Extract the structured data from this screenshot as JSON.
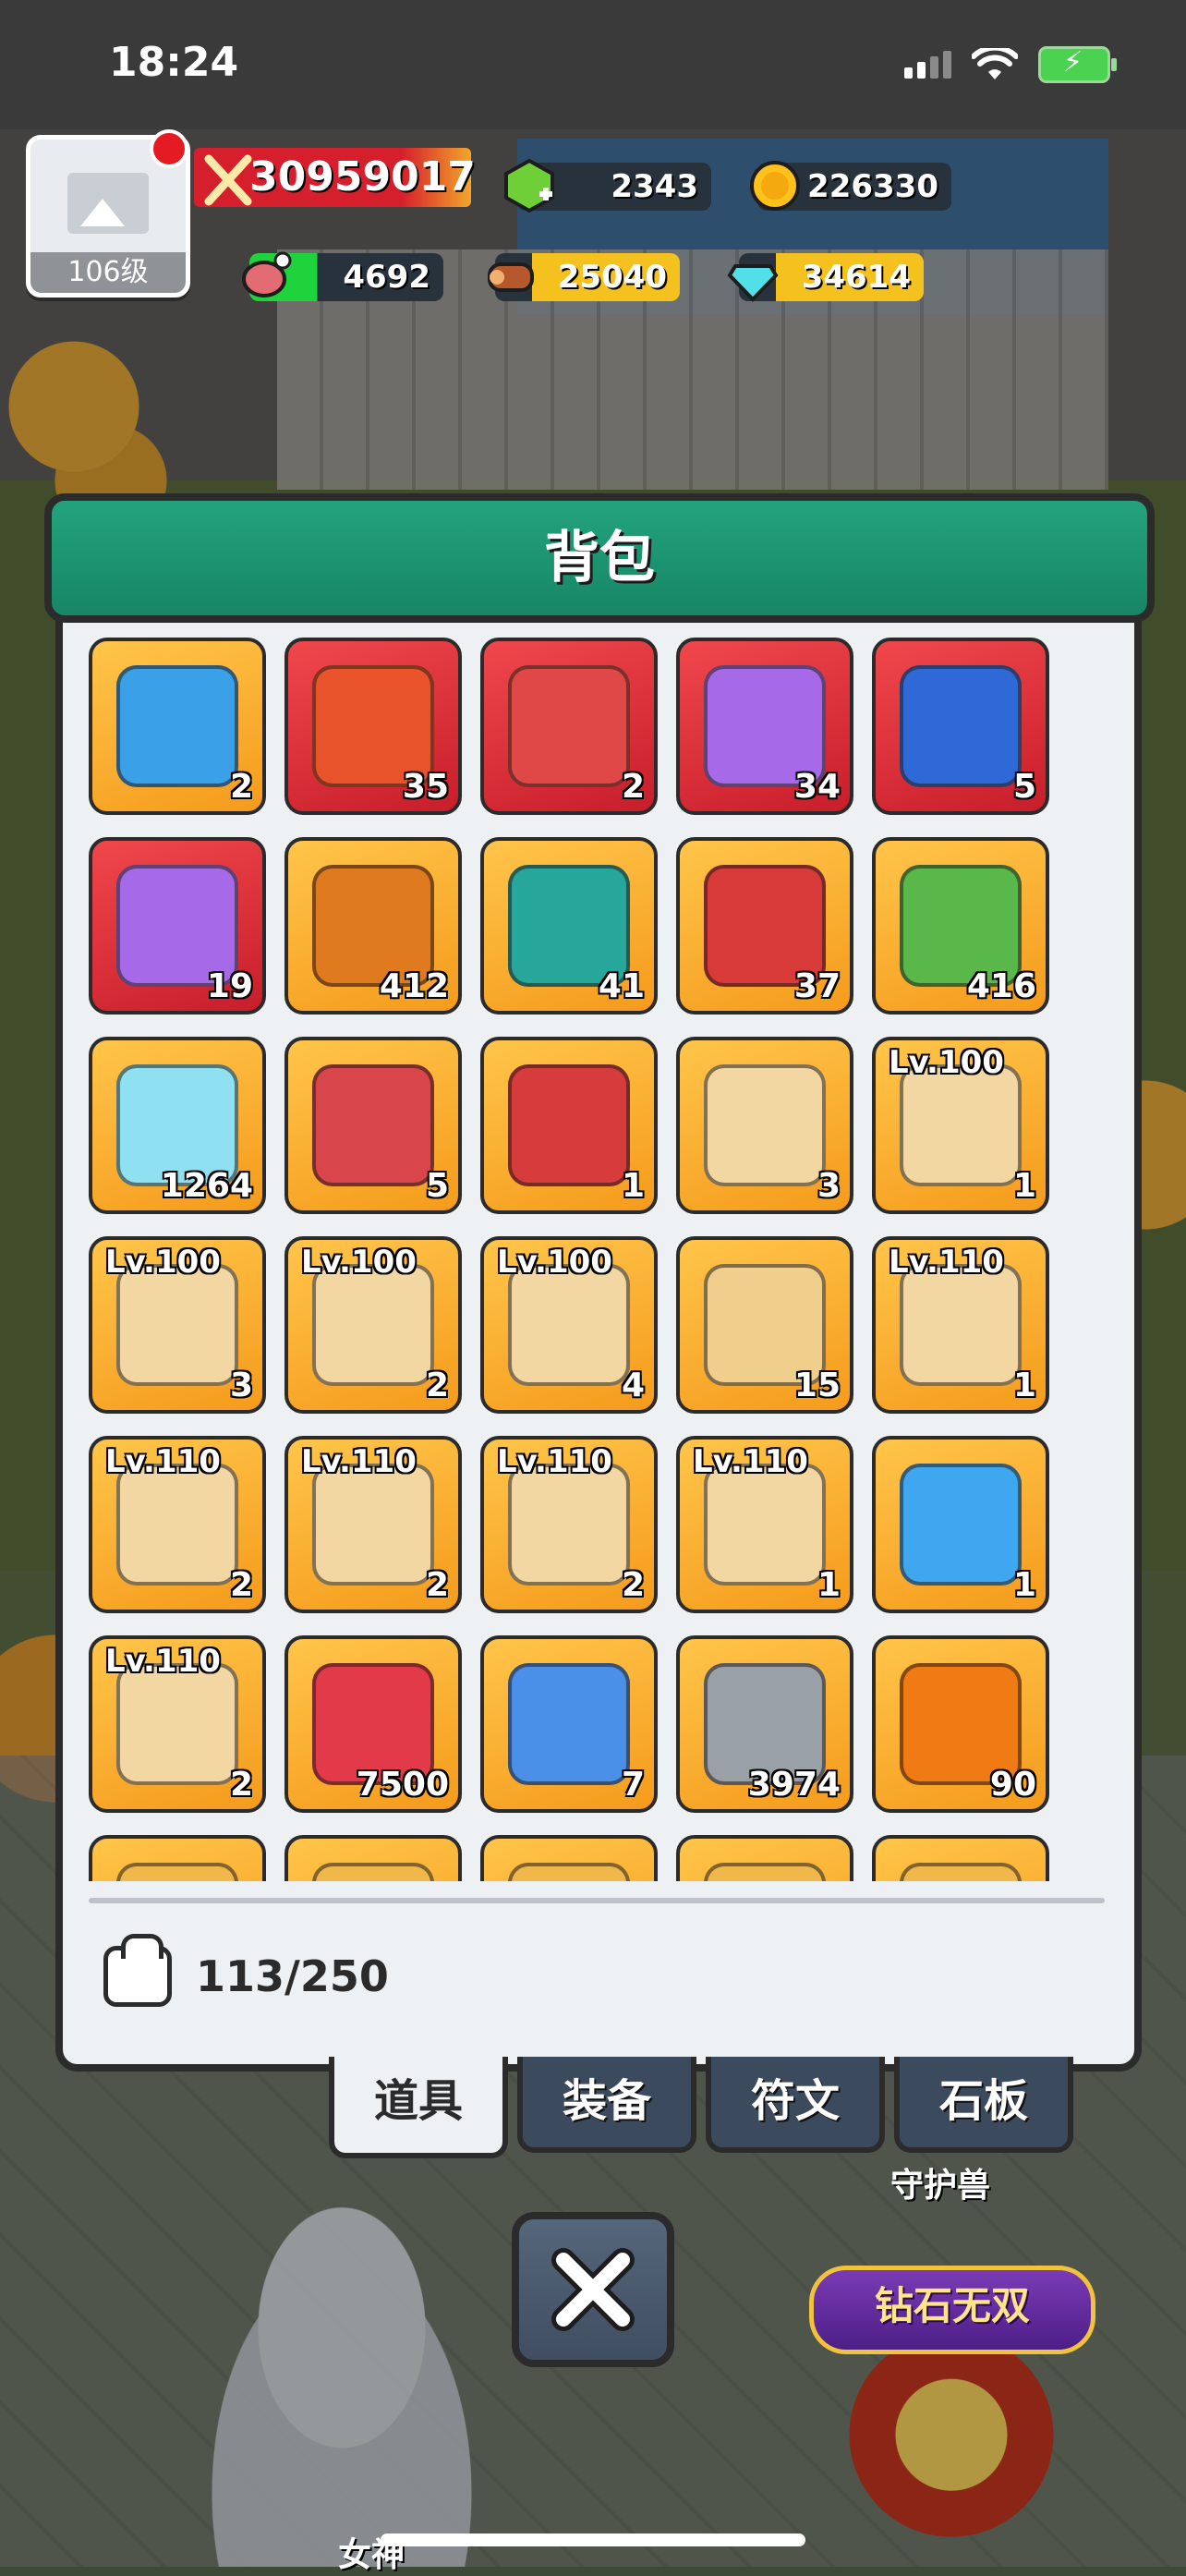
{
  "status_bar": {
    "time": "18:24"
  },
  "player": {
    "level_label": "106级",
    "power": "30959017"
  },
  "resources": {
    "gems_green": "2343",
    "gold": "226330",
    "meat": "4692",
    "wood": "25040",
    "crystal": "34614"
  },
  "panel": {
    "title": "背包",
    "capacity": "113/250"
  },
  "items": [
    {
      "icon": "blue-crown-chest-icon",
      "bg": "gold",
      "count": "2",
      "lv": ""
    },
    {
      "icon": "red-crown-card-icon",
      "bg": "red",
      "count": "35",
      "lv": ""
    },
    {
      "icon": "mystery-red-chest-icon",
      "bg": "red",
      "count": "2",
      "lv": ""
    },
    {
      "icon": "winged-purple-chest-icon",
      "bg": "red",
      "count": "34",
      "lv": ""
    },
    {
      "icon": "royal-blue-chest-icon",
      "bg": "red",
      "count": "5",
      "lv": ""
    },
    {
      "icon": "winged-purple-chest-icon",
      "bg": "red",
      "count": "19",
      "lv": ""
    },
    {
      "icon": "orange-crown-card-icon",
      "bg": "gold",
      "count": "412",
      "lv": ""
    },
    {
      "icon": "teal-gem-chest-icon",
      "bg": "gold",
      "count": "41",
      "lv": ""
    },
    {
      "icon": "red-gem-chest-icon",
      "bg": "gold",
      "count": "37",
      "lv": ""
    },
    {
      "icon": "pinwheel-icon",
      "bg": "gold",
      "count": "416",
      "lv": ""
    },
    {
      "icon": "glass-jar-icon",
      "bg": "gold",
      "count": "1264",
      "lv": ""
    },
    {
      "icon": "bow-ring-icon",
      "bg": "gold",
      "count": "5",
      "lv": ""
    },
    {
      "icon": "mystery-chest-icon",
      "bg": "gold",
      "count": "1",
      "lv": ""
    },
    {
      "icon": "boot-scroll-icon",
      "bg": "gold",
      "count": "3",
      "lv": ""
    },
    {
      "icon": "sword-scroll-icon",
      "bg": "gold",
      "count": "1",
      "lv": "Lv.100"
    },
    {
      "icon": "belt-scroll-icon",
      "bg": "gold",
      "count": "3",
      "lv": "Lv.100"
    },
    {
      "icon": "helmet-scroll-icon",
      "bg": "gold",
      "count": "2",
      "lv": "Lv.100"
    },
    {
      "icon": "boot-scroll-icon",
      "bg": "gold",
      "count": "4",
      "lv": "Lv.100"
    },
    {
      "icon": "rolled-scroll-icon",
      "bg": "gold",
      "count": "15",
      "lv": ""
    },
    {
      "icon": "shield-scroll-icon",
      "bg": "gold",
      "count": "1",
      "lv": "Lv.110"
    },
    {
      "icon": "belt-scroll-icon",
      "bg": "gold",
      "count": "2",
      "lv": "Lv.110"
    },
    {
      "icon": "helmet-scroll-icon",
      "bg": "gold",
      "count": "2",
      "lv": "Lv.110"
    },
    {
      "icon": "armor-scroll-icon",
      "bg": "gold",
      "count": "2",
      "lv": "Lv.110"
    },
    {
      "icon": "boot-scroll-icon",
      "bg": "gold",
      "count": "1",
      "lv": "Lv.110"
    },
    {
      "icon": "blue-potion-icon",
      "bg": "gold",
      "count": "1",
      "lv": ""
    },
    {
      "icon": "sword-scroll-icon",
      "bg": "gold",
      "count": "2",
      "lv": "Lv.110"
    },
    {
      "icon": "star-ruby-icon",
      "bg": "gold",
      "count": "7500",
      "lv": ""
    },
    {
      "icon": "ticket-icon",
      "bg": "gold",
      "count": "7",
      "lv": ""
    },
    {
      "icon": "stone-ore-icon",
      "bg": "gold",
      "count": "3974",
      "lv": ""
    },
    {
      "icon": "amber-gem-icon",
      "bg": "gold",
      "count": "90",
      "lv": ""
    },
    {
      "icon": "item-partial",
      "bg": "gold",
      "count": "",
      "lv": ""
    },
    {
      "icon": "item-partial",
      "bg": "gold",
      "count": "",
      "lv": ""
    },
    {
      "icon": "item-partial",
      "bg": "gold",
      "count": "",
      "lv": ""
    },
    {
      "icon": "item-partial",
      "bg": "gold",
      "count": "",
      "lv": ""
    },
    {
      "icon": "item-partial",
      "bg": "gold",
      "count": "",
      "lv": ""
    }
  ],
  "tabs": [
    {
      "label": "道具",
      "active": true
    },
    {
      "label": "装备",
      "active": false
    },
    {
      "label": "符文",
      "active": false
    },
    {
      "label": "石板",
      "active": false
    }
  ],
  "scene": {
    "guardian_label": "守护兽",
    "promo_label": "钻石无双",
    "goddess_label": "女神"
  },
  "colors": {
    "header_green": "#1f9a74",
    "tile_gold": "#f5a623",
    "tile_red": "#d92d36",
    "tab_dark": "#3b4a5c"
  }
}
